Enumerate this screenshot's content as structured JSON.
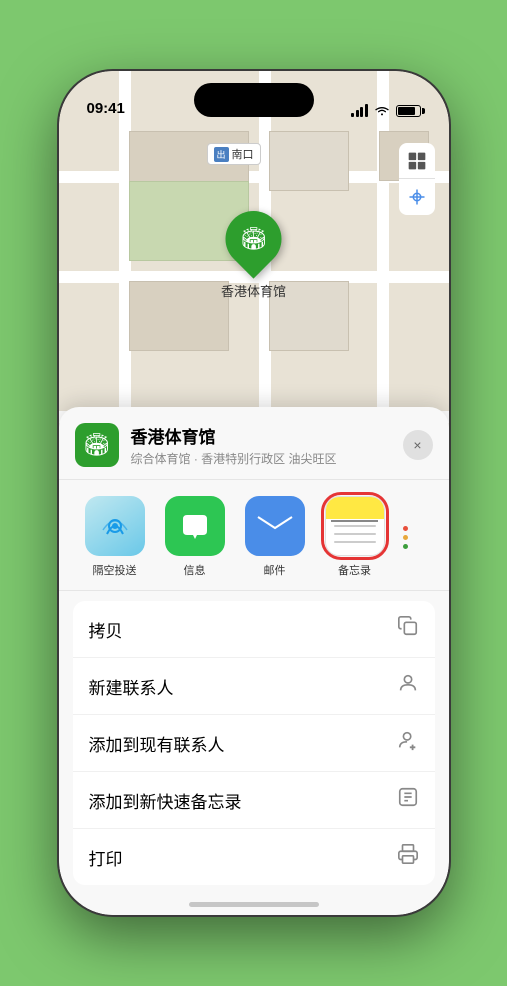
{
  "statusBar": {
    "time": "09:41",
    "locationArrow": "▶"
  },
  "mapControls": {
    "mapIcon": "🗺",
    "locationIcon": "➤"
  },
  "mapLabel": {
    "prefix": "出口",
    "text": "南口"
  },
  "pin": {
    "label": "香港体育馆"
  },
  "venueHeader": {
    "name": "香港体育馆",
    "desc": "综合体育馆 · 香港特别行政区 油尖旺区",
    "closeLabel": "×"
  },
  "shareItems": [
    {
      "id": "airdrop",
      "label": "隔空投送"
    },
    {
      "id": "message",
      "label": "信息"
    },
    {
      "id": "mail",
      "label": "邮件"
    },
    {
      "id": "notes",
      "label": "备忘录"
    }
  ],
  "actionItems": [
    {
      "id": "copy",
      "label": "拷贝",
      "icon": "📋"
    },
    {
      "id": "new-contact",
      "label": "新建联系人",
      "icon": "👤"
    },
    {
      "id": "add-existing",
      "label": "添加到现有联系人",
      "icon": "👤"
    },
    {
      "id": "quick-note",
      "label": "添加到新快速备忘录",
      "icon": "📝"
    },
    {
      "id": "print",
      "label": "打印",
      "icon": "🖨"
    }
  ]
}
